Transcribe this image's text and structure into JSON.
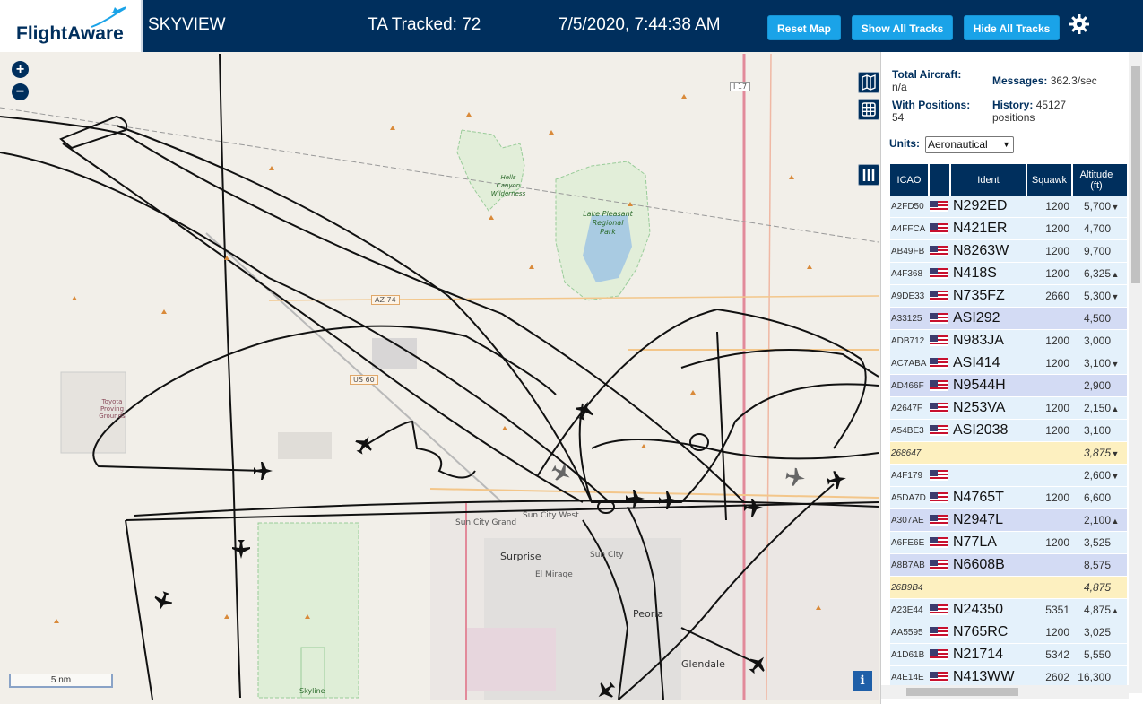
{
  "header": {
    "logo_text": "FlightAware",
    "site_name": "SKYVIEW",
    "tracked": "TA Tracked: 72",
    "datetime": "7/5/2020, 7:44:38 AM",
    "buttons": {
      "reset": "Reset Map",
      "show": "Show All Tracks",
      "hide": "Hide All Tracks"
    }
  },
  "map": {
    "zoom_in": "+",
    "zoom_out": "−",
    "scale": "5 nm",
    "info": "i",
    "labels": {
      "hells_canyon": "Hells Canyon\nWilderness",
      "lake_pleasant": "Lake Pleasant\nRegional\nPark",
      "toyota": "Toyota\nProving\nGrounds",
      "sun_city_grand": "Sun City Grand",
      "sun_city_west": "Sun City West",
      "surprise": "Surprise",
      "sun_city": "Sun City",
      "el_mirage": "El Mirage",
      "peoria": "Peoria",
      "glendale": "Glendale",
      "skyline": "Skyline",
      "az74": "AZ 74",
      "us60": "US 60",
      "i17": "I 17"
    }
  },
  "stats": {
    "total_label": "Total Aircraft:",
    "total_value": "n/a",
    "messages_label": "Messages:",
    "messages_value": "362.3/sec",
    "positions_label": "With Positions:",
    "positions_value": "54",
    "history_label": "History:",
    "history_value": "45127",
    "history_unit": "positions"
  },
  "units": {
    "label": "Units:",
    "selected": "Aeronautical"
  },
  "table": {
    "headers": {
      "icao": "ICAO",
      "ident": "Ident",
      "squawk": "Squawk",
      "altitude": "Altitude\n(ft)"
    },
    "rows": [
      {
        "icao": "A2FD50",
        "flag": true,
        "ident": "N292ED",
        "squawk": "1200",
        "alt": "5,700",
        "arrow": "▼",
        "bg": "#e4f1fb",
        "italic": false
      },
      {
        "icao": "A4FFCA",
        "flag": true,
        "ident": "N421ER",
        "squawk": "1200",
        "alt": "4,700",
        "arrow": "",
        "bg": "#e4f1fb",
        "italic": false
      },
      {
        "icao": "AB49FB",
        "flag": true,
        "ident": "N8263W",
        "squawk": "1200",
        "alt": "9,700",
        "arrow": "",
        "bg": "#e4f1fb",
        "italic": false
      },
      {
        "icao": "A4F368",
        "flag": true,
        "ident": "N418S",
        "squawk": "1200",
        "alt": "6,325",
        "arrow": "▲",
        "bg": "#e4f1fb",
        "italic": false
      },
      {
        "icao": "A9DE33",
        "flag": true,
        "ident": "N735FZ",
        "squawk": "2660",
        "alt": "5,300",
        "arrow": "▼",
        "bg": "#e4f1fb",
        "italic": false
      },
      {
        "icao": "A33125",
        "flag": true,
        "ident": "ASI292",
        "squawk": "",
        "alt": "4,500",
        "arrow": "",
        "bg": "#d3dbf4",
        "italic": false
      },
      {
        "icao": "ADB712",
        "flag": true,
        "ident": "N983JA",
        "squawk": "1200",
        "alt": "3,000",
        "arrow": "",
        "bg": "#e4f1fb",
        "italic": false
      },
      {
        "icao": "AC7ABA",
        "flag": true,
        "ident": "ASI414",
        "squawk": "1200",
        "alt": "3,100",
        "arrow": "▼",
        "bg": "#e4f1fb",
        "italic": false
      },
      {
        "icao": "AD466F",
        "flag": true,
        "ident": "N9544H",
        "squawk": "",
        "alt": "2,900",
        "arrow": "",
        "bg": "#d3dbf4",
        "italic": false
      },
      {
        "icao": "A2647F",
        "flag": true,
        "ident": "N253VA",
        "squawk": "1200",
        "alt": "2,150",
        "arrow": "▲",
        "bg": "#e4f1fb",
        "italic": false
      },
      {
        "icao": "A54BE3",
        "flag": true,
        "ident": "ASI2038",
        "squawk": "1200",
        "alt": "3,100",
        "arrow": "",
        "bg": "#e4f1fb",
        "italic": false
      },
      {
        "icao": "268647",
        "flag": false,
        "ident": "",
        "squawk": "",
        "alt": "3,875",
        "arrow": "▼",
        "bg": "#fdf0c0",
        "italic": true
      },
      {
        "icao": "A4F179",
        "flag": true,
        "ident": "",
        "squawk": "",
        "alt": "2,600",
        "arrow": "▼",
        "bg": "#e4f1fb",
        "italic": false
      },
      {
        "icao": "A5DA7D",
        "flag": true,
        "ident": "N4765T",
        "squawk": "1200",
        "alt": "6,600",
        "arrow": "",
        "bg": "#e4f1fb",
        "italic": false
      },
      {
        "icao": "A307AE",
        "flag": true,
        "ident": "N2947L",
        "squawk": "",
        "alt": "2,100",
        "arrow": "▲",
        "bg": "#d3dbf4",
        "italic": false
      },
      {
        "icao": "A6FE6E",
        "flag": true,
        "ident": "N77LA",
        "squawk": "1200",
        "alt": "3,525",
        "arrow": "",
        "bg": "#e4f1fb",
        "italic": false
      },
      {
        "icao": "A8B7AB",
        "flag": true,
        "ident": "N6608B",
        "squawk": "",
        "alt": "8,575",
        "arrow": "",
        "bg": "#d3dbf4",
        "italic": false
      },
      {
        "icao": "26B9B4",
        "flag": false,
        "ident": "",
        "squawk": "",
        "alt": "4,875",
        "arrow": "",
        "bg": "#fdf0c0",
        "italic": true
      },
      {
        "icao": "A23E44",
        "flag": true,
        "ident": "N24350",
        "squawk": "5351",
        "alt": "4,875",
        "arrow": "▲",
        "bg": "#e4f1fb",
        "italic": false
      },
      {
        "icao": "AA5595",
        "flag": true,
        "ident": "N765RC",
        "squawk": "1200",
        "alt": "3,025",
        "arrow": "",
        "bg": "#e4f1fb",
        "italic": false
      },
      {
        "icao": "A1D61B",
        "flag": true,
        "ident": "N21714",
        "squawk": "5342",
        "alt": "5,550",
        "arrow": "",
        "bg": "#e4f1fb",
        "italic": false
      },
      {
        "icao": "A4E14E",
        "flag": true,
        "ident": "N413WW",
        "squawk": "2602",
        "alt": "16,300",
        "arrow": "",
        "bg": "#e4f1fb",
        "italic": false
      }
    ]
  },
  "colors": {
    "header_bg": "#002f5d",
    "button": "#1aa3e8",
    "selected_row": "#d3dbf4",
    "row": "#e4f1fb",
    "mlat_row": "#fdf0c0"
  }
}
